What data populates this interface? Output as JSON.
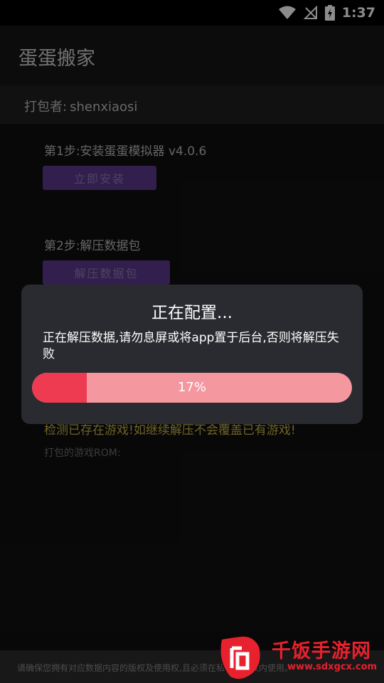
{
  "status_bar": {
    "time": "1:37",
    "icons": [
      "wifi-icon",
      "no-signal-icon",
      "battery-charging-icon"
    ]
  },
  "app": {
    "title": "蛋蛋搬家",
    "packer_label": "打包者:",
    "packer_name": "shenxiaosi"
  },
  "steps": [
    {
      "label": "第1步:安装蛋蛋模拟器 v4.0.6",
      "button": "立即安装"
    },
    {
      "label": "第2步:解压数据包",
      "button": "解压数据包"
    }
  ],
  "notice": {
    "warning": "检测已存在游戏!如继续解压不会覆盖已有游戏!",
    "rom_label": "打包的游戏ROM:"
  },
  "dialog": {
    "title": "正在配置...",
    "message": "正在解压数据,请勿息屏或将app置于后台,否则将解压失败",
    "progress_label": "17%",
    "progress_value": 0.17
  },
  "footer": {
    "text": "请确保您拥有对应数据内容的版权及使用权,且必须在私有网络以内使用。",
    "watermark_text": "千饭手游网",
    "watermark_url": "www.sdxgcx.com"
  },
  "colors": {
    "accent_purple": "#5b3a8f",
    "progress_fill": "#ee3b52",
    "progress_track": "#f5979f",
    "warning": "#c9b44a"
  }
}
